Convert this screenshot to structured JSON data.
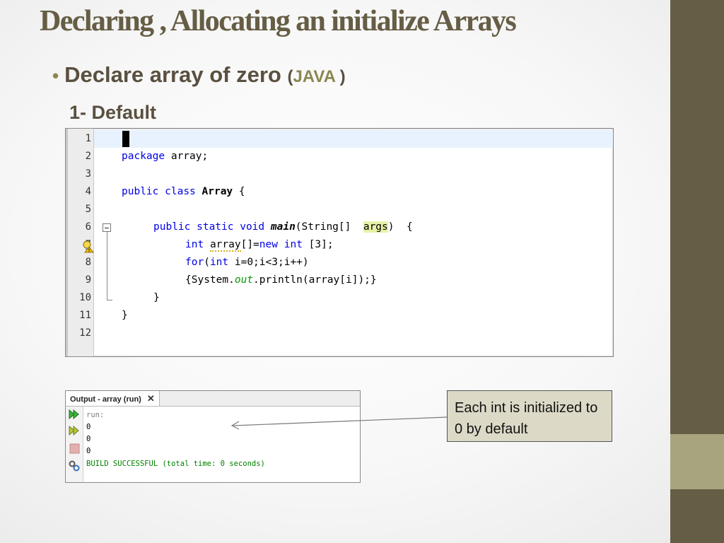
{
  "slide": {
    "title": "Declaring , Allocating an initialize Arrays",
    "bullet": {
      "text": "Declare array of zero ",
      "paren_open": "(",
      "lang": "JAVA",
      "paren_close": " )"
    },
    "subheading": "1- Default"
  },
  "editor": {
    "line_numbers": [
      "1",
      "2",
      "3",
      "4",
      "5",
      "6",
      "7",
      "8",
      "9",
      "10",
      "11",
      "12"
    ],
    "tokens": {
      "package_kw": "package",
      "package_rest": " array;",
      "public_kw": "public",
      "class_kw": "class",
      "class_name": "Array",
      "brace_open": " {",
      "public_static_void": "public static void",
      "main_name": "main",
      "main_params": "(String[] ",
      "args": "args",
      "main_tail": ")  {",
      "int_kw": "int",
      "array_ident": "array",
      "decl_mid": "[]=",
      "new_kw": "new",
      "int_kw2": "int",
      "decl_tail": " [3];",
      "for_kw": "for",
      "for_open": "(",
      "int_kw3": "int",
      "for_tail": " i=0;i<3;i++)",
      "print_head": "{System.",
      "out_field": "out",
      "print_tail": ".println(array[i]);}",
      "close_method": "}",
      "close_class": "}"
    }
  },
  "output": {
    "tab_label": "Output - array (run)",
    "close_symbol": "✕",
    "lines": [
      "run:",
      "0",
      "0",
      "0",
      "BUILD SUCCESSFUL (total time: 0 seconds)"
    ]
  },
  "callout": {
    "text": "Each int is initialized to 0 by default"
  },
  "colors": {
    "title": "#665d45",
    "sidebar": "#665d45",
    "sidebar_accent": "#a8a47e",
    "keyword": "#0000e6",
    "success": "#008000",
    "callout_bg": "#dcd9c7"
  }
}
